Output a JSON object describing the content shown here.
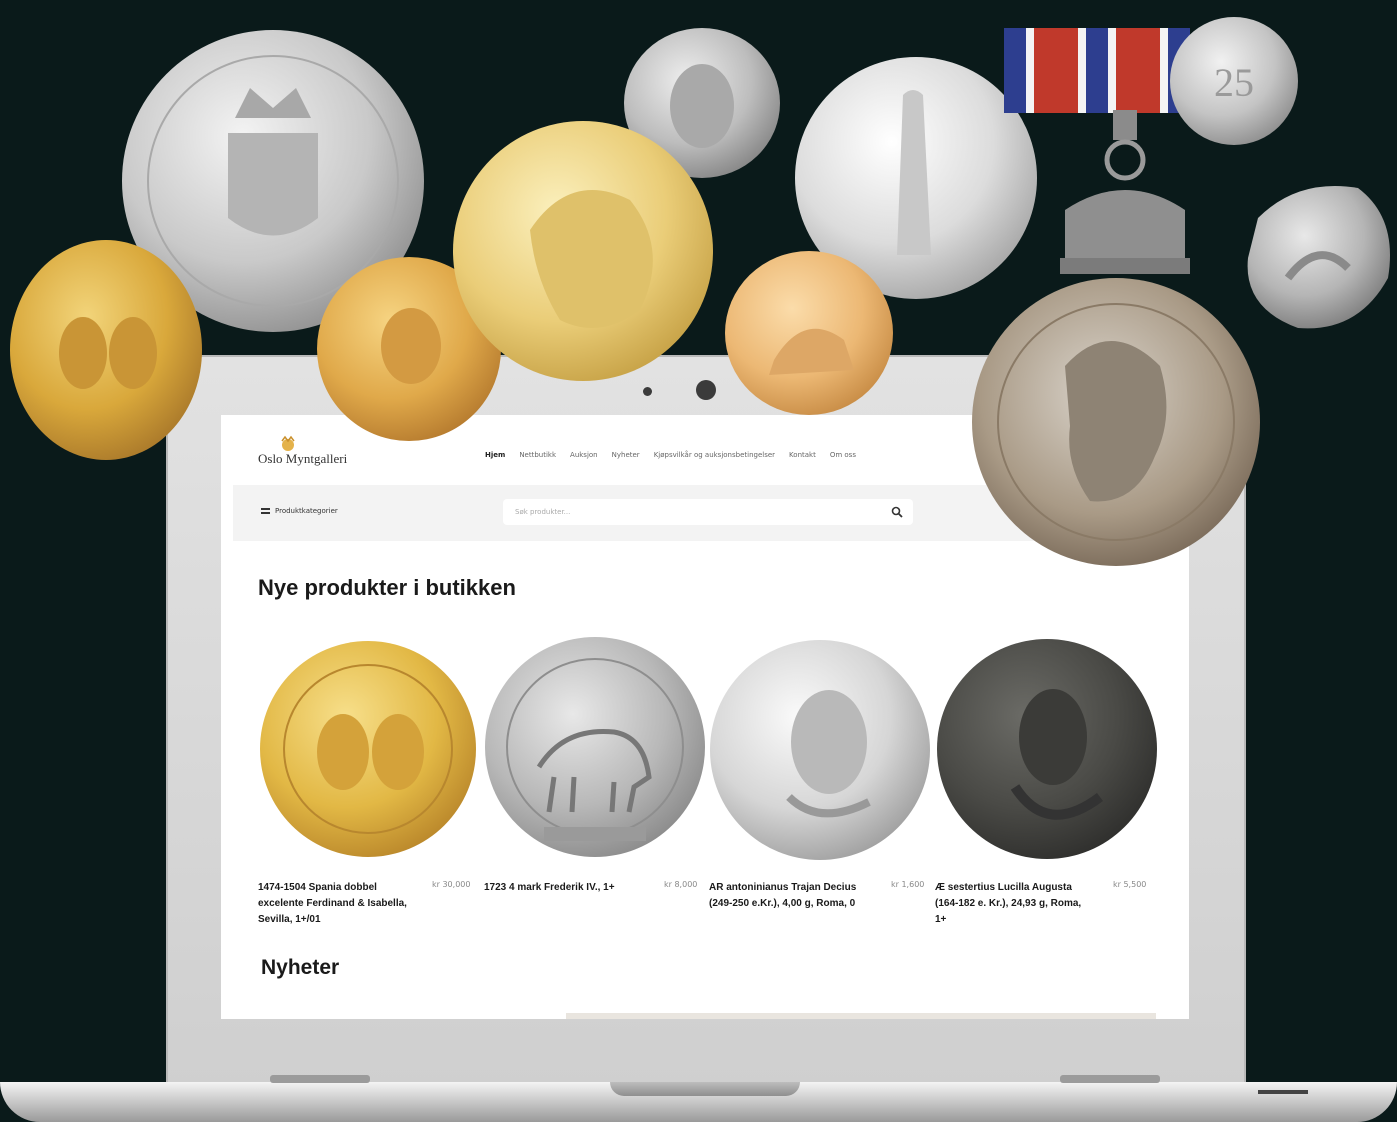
{
  "site": {
    "logo_text": "Oslo Myntgalleri",
    "nav": [
      "Hjem",
      "Nettbutikk",
      "Auksjon",
      "Nyheter",
      "Kjøpsvilkår og auksjonsbetingelser",
      "Kontakt",
      "Om oss"
    ],
    "category_menu_label": "Produktkategorier",
    "search_placeholder": "Søk produkter..."
  },
  "main": {
    "new_products_title": "Nye produkter i butikken",
    "news_title": "Nyheter",
    "products": [
      {
        "name": "1474-1504 Spania dobbel excelente Ferdinand & Isabella, Sevilla, 1+/01",
        "price": "kr 30,000",
        "metal": "gold"
      },
      {
        "name": "1723 4 mark Frederik IV., 1+",
        "price": "kr 8,000",
        "metal": "silver"
      },
      {
        "name": "AR antoninianus Trajan Decius (249-250 e.Kr.), 4,00 g, Roma, 0",
        "price": "kr 1,600",
        "metal": "silver-bright"
      },
      {
        "name": "Æ sestertius Lucilla Augusta (164-182 e. Kr.), 24,93 g, Roma, 1+",
        "price": "kr 5,500",
        "metal": "bronze-dark"
      }
    ]
  },
  "colors": {
    "background": "#0a1a1a",
    "gold": "#e2b845",
    "silver": "#c9c9c9",
    "bronze": "#4a4a46"
  }
}
